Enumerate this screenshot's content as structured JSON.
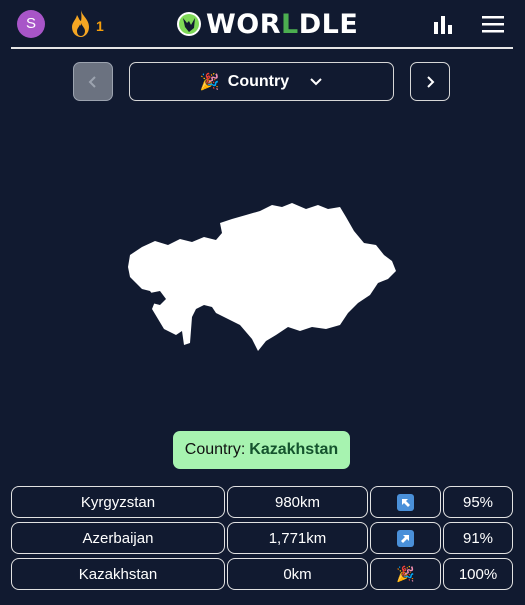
{
  "header": {
    "avatar_initial": "S",
    "streak_count": "1",
    "logo_prefix": "WOR",
    "logo_accent": "L",
    "logo_suffix": "DLE"
  },
  "game_nav": {
    "prev_icon": "chevron-left-icon",
    "next_icon": "chevron-right-icon",
    "mode_emoji": "🎉",
    "mode_label": "Country",
    "mode_icon": "chevron-down-icon"
  },
  "answer": {
    "label": "Country:",
    "value": "Kazakhstan"
  },
  "guesses": [
    {
      "country": "Kyrgyzstan",
      "distance": "980km",
      "direction_icon": "arrow-up-left-icon",
      "proximity": "95%"
    },
    {
      "country": "Azerbaijan",
      "distance": "1,771km",
      "direction_icon": "arrow-up-right-icon",
      "proximity": "91%"
    },
    {
      "country": "Kazakhstan",
      "distance": "0km",
      "direction_icon": "party-popper-icon",
      "direction_emoji": "🎉",
      "proximity": "100%"
    }
  ],
  "colors": {
    "background": "#111a30",
    "accent_green": "#4caf50",
    "answer_bg": "#a7f3b0",
    "streak": "#f59e0b",
    "avatar": "#a855c8",
    "direction_arrow_bg": "#4a90d9"
  }
}
